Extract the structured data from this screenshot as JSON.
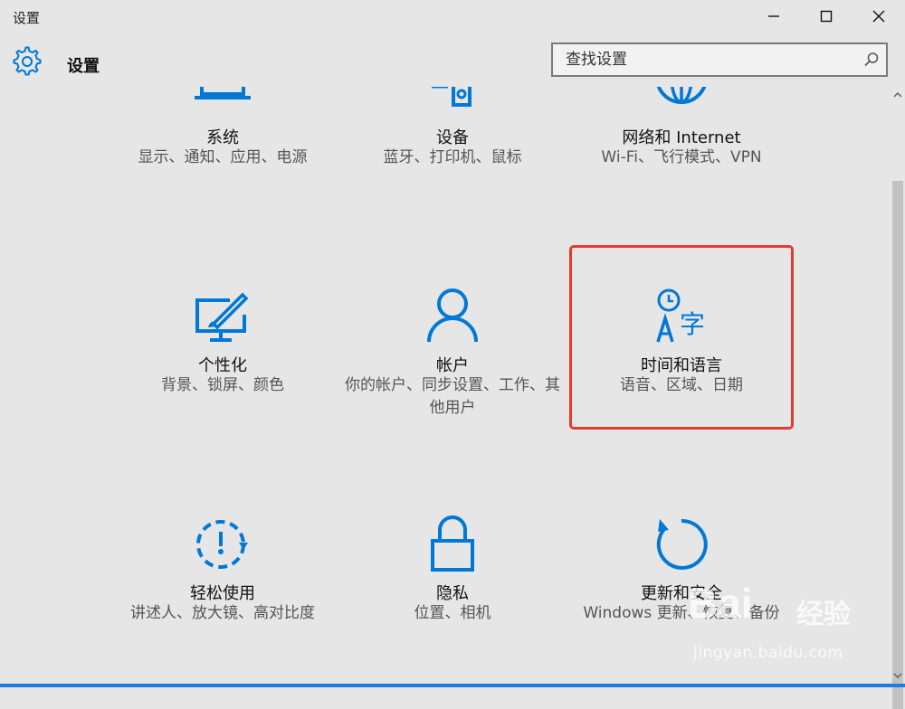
{
  "window": {
    "title": "设置"
  },
  "header": {
    "app_name": "设置"
  },
  "search": {
    "placeholder": "查找设置"
  },
  "tiles": [
    {
      "name": "系统",
      "desc": "显示、通知、应用、电源",
      "icon": "laptop-icon"
    },
    {
      "name": "设备",
      "desc": "蓝牙、打印机、鼠标",
      "icon": "devices-icon"
    },
    {
      "name": "网络和 Internet",
      "desc": "Wi-Fi、飞行模式、VPN",
      "icon": "globe-icon"
    },
    {
      "name": "个性化",
      "desc": "背景、锁屏、颜色",
      "icon": "personalization-icon"
    },
    {
      "name": "帐户",
      "desc": "你的帐户、同步设置、工作、其他用户",
      "icon": "person-icon"
    },
    {
      "name": "时间和语言",
      "desc": "语音、区域、日期",
      "icon": "time-language-icon"
    },
    {
      "name": "轻松使用",
      "desc": "讲述人、放大镜、高对比度",
      "icon": "ease-of-access-icon"
    },
    {
      "name": "隐私",
      "desc": "位置、相机",
      "icon": "lock-icon"
    },
    {
      "name": "更新和安全",
      "desc": "Windows 更新、恢复、备份",
      "icon": "update-icon"
    }
  ],
  "colors": {
    "accent": "#0078d7",
    "highlight": "#e53b2c",
    "background": "#e6e6e6"
  },
  "watermark": {
    "logo": "Bai",
    "brand": "经验",
    "url": "jingyan.baidu.com"
  }
}
